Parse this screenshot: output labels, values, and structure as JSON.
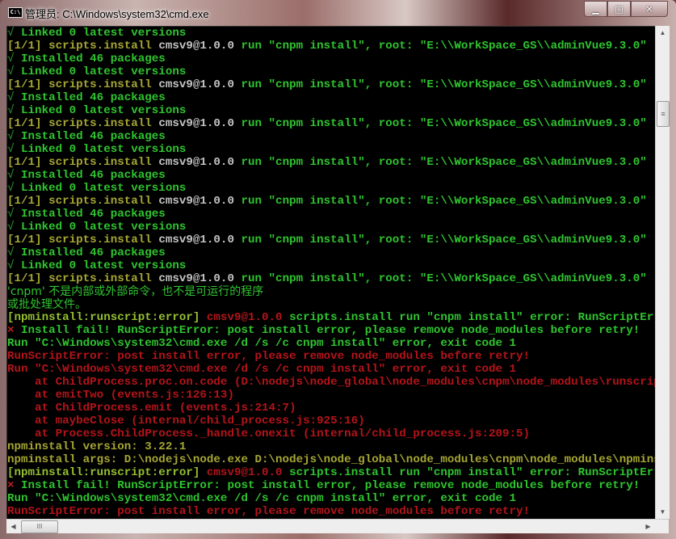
{
  "window": {
    "title": "管理员: C:\\Windows\\system32\\cmd.exe",
    "icon_label": "C:\\",
    "minimize": "▁",
    "maximize": "□",
    "close": "✕"
  },
  "scrollbar": {
    "up": "▲",
    "down": "▼",
    "left": "◀",
    "right": "▶",
    "grip": "≡",
    "hgrip": "III"
  },
  "colors": {
    "green": "#2fc52f",
    "olive": "#a6a634",
    "gray": "#c4c4c4",
    "red": "#b4141a",
    "background": "#000000"
  },
  "console": {
    "lines": [
      [
        {
          "t": "√ ",
          "c": "C"
        },
        {
          "t": "Linked 0 latest versions",
          "c": "G"
        }
      ],
      [
        {
          "t": "[1/1] scripts.install ",
          "c": "Y"
        },
        {
          "t": "cmsv9@1.0.0 ",
          "c": "W"
        },
        {
          "t": "run \"cnpm install\", root: \"E:\\\\WorkSpace_GS\\\\adminVue9.3.0\"",
          "c": "G"
        }
      ],
      [
        {
          "t": "√ ",
          "c": "C"
        },
        {
          "t": "Installed 46 packages",
          "c": "G"
        }
      ],
      [
        {
          "t": "√ ",
          "c": "C"
        },
        {
          "t": "Linked 0 latest versions",
          "c": "G"
        }
      ],
      [
        {
          "t": "[1/1] scripts.install ",
          "c": "Y"
        },
        {
          "t": "cmsv9@1.0.0 ",
          "c": "W"
        },
        {
          "t": "run \"cnpm install\", root: \"E:\\\\WorkSpace_GS\\\\adminVue9.3.0\"",
          "c": "G"
        }
      ],
      [
        {
          "t": "√ ",
          "c": "C"
        },
        {
          "t": "Installed 46 packages",
          "c": "G"
        }
      ],
      [
        {
          "t": "√ ",
          "c": "C"
        },
        {
          "t": "Linked 0 latest versions",
          "c": "G"
        }
      ],
      [
        {
          "t": "[1/1] scripts.install ",
          "c": "Y"
        },
        {
          "t": "cmsv9@1.0.0 ",
          "c": "W"
        },
        {
          "t": "run \"cnpm install\", root: \"E:\\\\WorkSpace_GS\\\\adminVue9.3.0\"",
          "c": "G"
        }
      ],
      [
        {
          "t": "√ ",
          "c": "C"
        },
        {
          "t": "Installed 46 packages",
          "c": "G"
        }
      ],
      [
        {
          "t": "√ ",
          "c": "C"
        },
        {
          "t": "Linked 0 latest versions",
          "c": "G"
        }
      ],
      [
        {
          "t": "[1/1] scripts.install ",
          "c": "Y"
        },
        {
          "t": "cmsv9@1.0.0 ",
          "c": "W"
        },
        {
          "t": "run \"cnpm install\", root: \"E:\\\\WorkSpace_GS\\\\adminVue9.3.0\"",
          "c": "G"
        }
      ],
      [
        {
          "t": "√ ",
          "c": "C"
        },
        {
          "t": "Installed 46 packages",
          "c": "G"
        }
      ],
      [
        {
          "t": "√ ",
          "c": "C"
        },
        {
          "t": "Linked 0 latest versions",
          "c": "G"
        }
      ],
      [
        {
          "t": "[1/1] scripts.install ",
          "c": "Y"
        },
        {
          "t": "cmsv9@1.0.0 ",
          "c": "W"
        },
        {
          "t": "run \"cnpm install\", root: \"E:\\\\WorkSpace_GS\\\\adminVue9.3.0\"",
          "c": "G"
        }
      ],
      [
        {
          "t": "√ ",
          "c": "C"
        },
        {
          "t": "Installed 46 packages",
          "c": "G"
        }
      ],
      [
        {
          "t": "√ ",
          "c": "C"
        },
        {
          "t": "Linked 0 latest versions",
          "c": "G"
        }
      ],
      [
        {
          "t": "[1/1] scripts.install ",
          "c": "Y"
        },
        {
          "t": "cmsv9@1.0.0 ",
          "c": "W"
        },
        {
          "t": "run \"cnpm install\", root: \"E:\\\\WorkSpace_GS\\\\adminVue9.3.0\"",
          "c": "G"
        }
      ],
      [
        {
          "t": "√ ",
          "c": "C"
        },
        {
          "t": "Installed 46 packages",
          "c": "G"
        }
      ],
      [
        {
          "t": "√ ",
          "c": "C"
        },
        {
          "t": "Linked 0 latest versions",
          "c": "G"
        }
      ],
      [
        {
          "t": "[1/1] scripts.install ",
          "c": "Y"
        },
        {
          "t": "cmsv9@1.0.0 ",
          "c": "W"
        },
        {
          "t": "run \"cnpm install\", root: \"E:\\\\WorkSpace_GS\\\\adminVue9.3.0\"",
          "c": "G"
        }
      ],
      [
        {
          "t": "'cnpm' 不是内部或外部命令，也不是可运行的程序",
          "c": "G cjk"
        }
      ],
      [
        {
          "t": "或批处理文件。",
          "c": "G cjk"
        }
      ],
      [
        {
          "t": "[npminstall:runscript:error] ",
          "c": "L"
        },
        {
          "t": "cmsv9@1.0.0 ",
          "c": "R"
        },
        {
          "t": "scripts.install run \"cnpm install\" error: RunScriptError: R",
          "c": "G"
        }
      ],
      [
        {
          "t": "× ",
          "c": "X"
        },
        {
          "t": "Install fail! RunScriptError: post install error, please remove node_modules before retry!",
          "c": "G"
        }
      ],
      [
        {
          "t": "Run \"C:\\Windows\\system32\\cmd.exe /d /s /c cnpm install\" error, exit code 1",
          "c": "G"
        }
      ],
      [
        {
          "t": "RunScriptError: post install error, please remove node_modules before retry!",
          "c": "R"
        }
      ],
      [
        {
          "t": "Run \"C:\\Windows\\system32\\cmd.exe /d /s /c cnpm install\" error, exit code 1",
          "c": "R"
        }
      ],
      [
        {
          "t": "    at ChildProcess.proc.on.code (D:\\nodejs\\node_global\\node_modules\\cnpm\\node_modules\\runscript\\ind",
          "c": "R"
        }
      ],
      [
        {
          "t": "    at emitTwo (events.js:126:13)",
          "c": "R"
        }
      ],
      [
        {
          "t": "    at ChildProcess.emit (events.js:214:7)",
          "c": "R"
        }
      ],
      [
        {
          "t": "    at maybeClose (internal/child_process.js:925:16)",
          "c": "R"
        }
      ],
      [
        {
          "t": "    at Process.ChildProcess._handle.onexit (internal/child_process.js:209:5)",
          "c": "R"
        }
      ],
      [
        {
          "t": "npminstall version: 3.22.1",
          "c": "Y"
        }
      ],
      [
        {
          "t": "npminstall args: D:\\nodejs\\node.exe D:\\nodejs\\node_global\\node_modules\\cnpm\\node_modules\\npminstall\\",
          "c": "Y"
        }
      ],
      [
        {
          "t": "[npminstall:runscript:error] ",
          "c": "L"
        },
        {
          "t": "cmsv9@1.0.0 ",
          "c": "R"
        },
        {
          "t": "scripts.install run \"cnpm install\" error: RunScriptError: R",
          "c": "G"
        }
      ],
      [
        {
          "t": "× ",
          "c": "X"
        },
        {
          "t": "Install fail! RunScriptError: post install error, please remove node_modules before retry!",
          "c": "G"
        }
      ],
      [
        {
          "t": "Run \"C:\\Windows\\system32\\cmd.exe /d /s /c cnpm install\" error, exit code 1",
          "c": "G"
        }
      ],
      [
        {
          "t": "RunScriptError: post install error, please remove node_modules before retry!",
          "c": "R"
        }
      ]
    ]
  }
}
